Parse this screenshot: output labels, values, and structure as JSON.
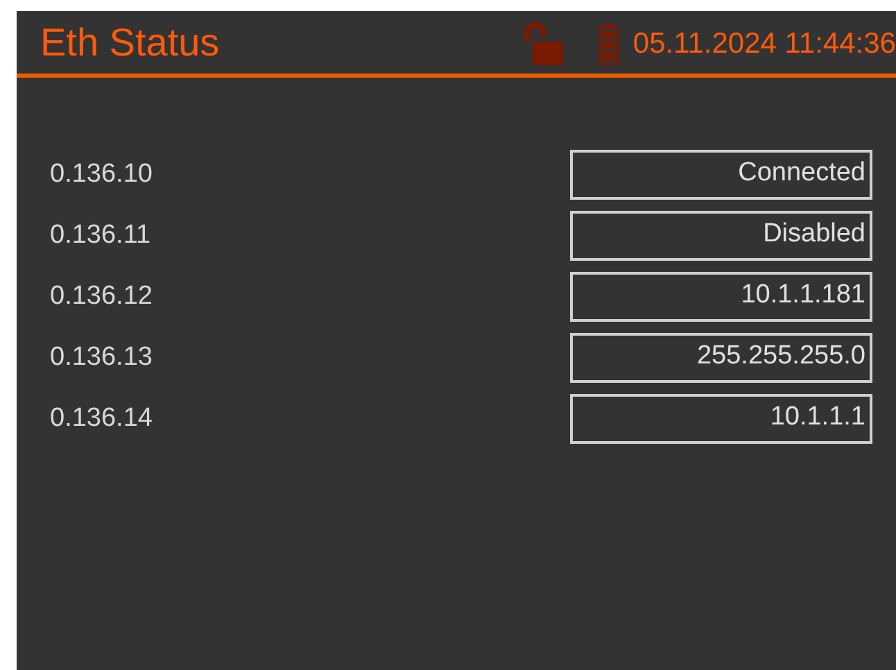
{
  "header": {
    "title": "Eth Status",
    "datetime": "05.11.2024 11:44:36"
  },
  "rows": [
    {
      "label": "0.136.10",
      "value": "Connected"
    },
    {
      "label": "0.136.11",
      "value": "Disabled"
    },
    {
      "label": "0.136.12",
      "value": "10.1.1.181"
    },
    {
      "label": "0.136.13",
      "value": "255.255.255.0"
    },
    {
      "label": "0.136.14",
      "value": "10.1.1.1"
    }
  ]
}
